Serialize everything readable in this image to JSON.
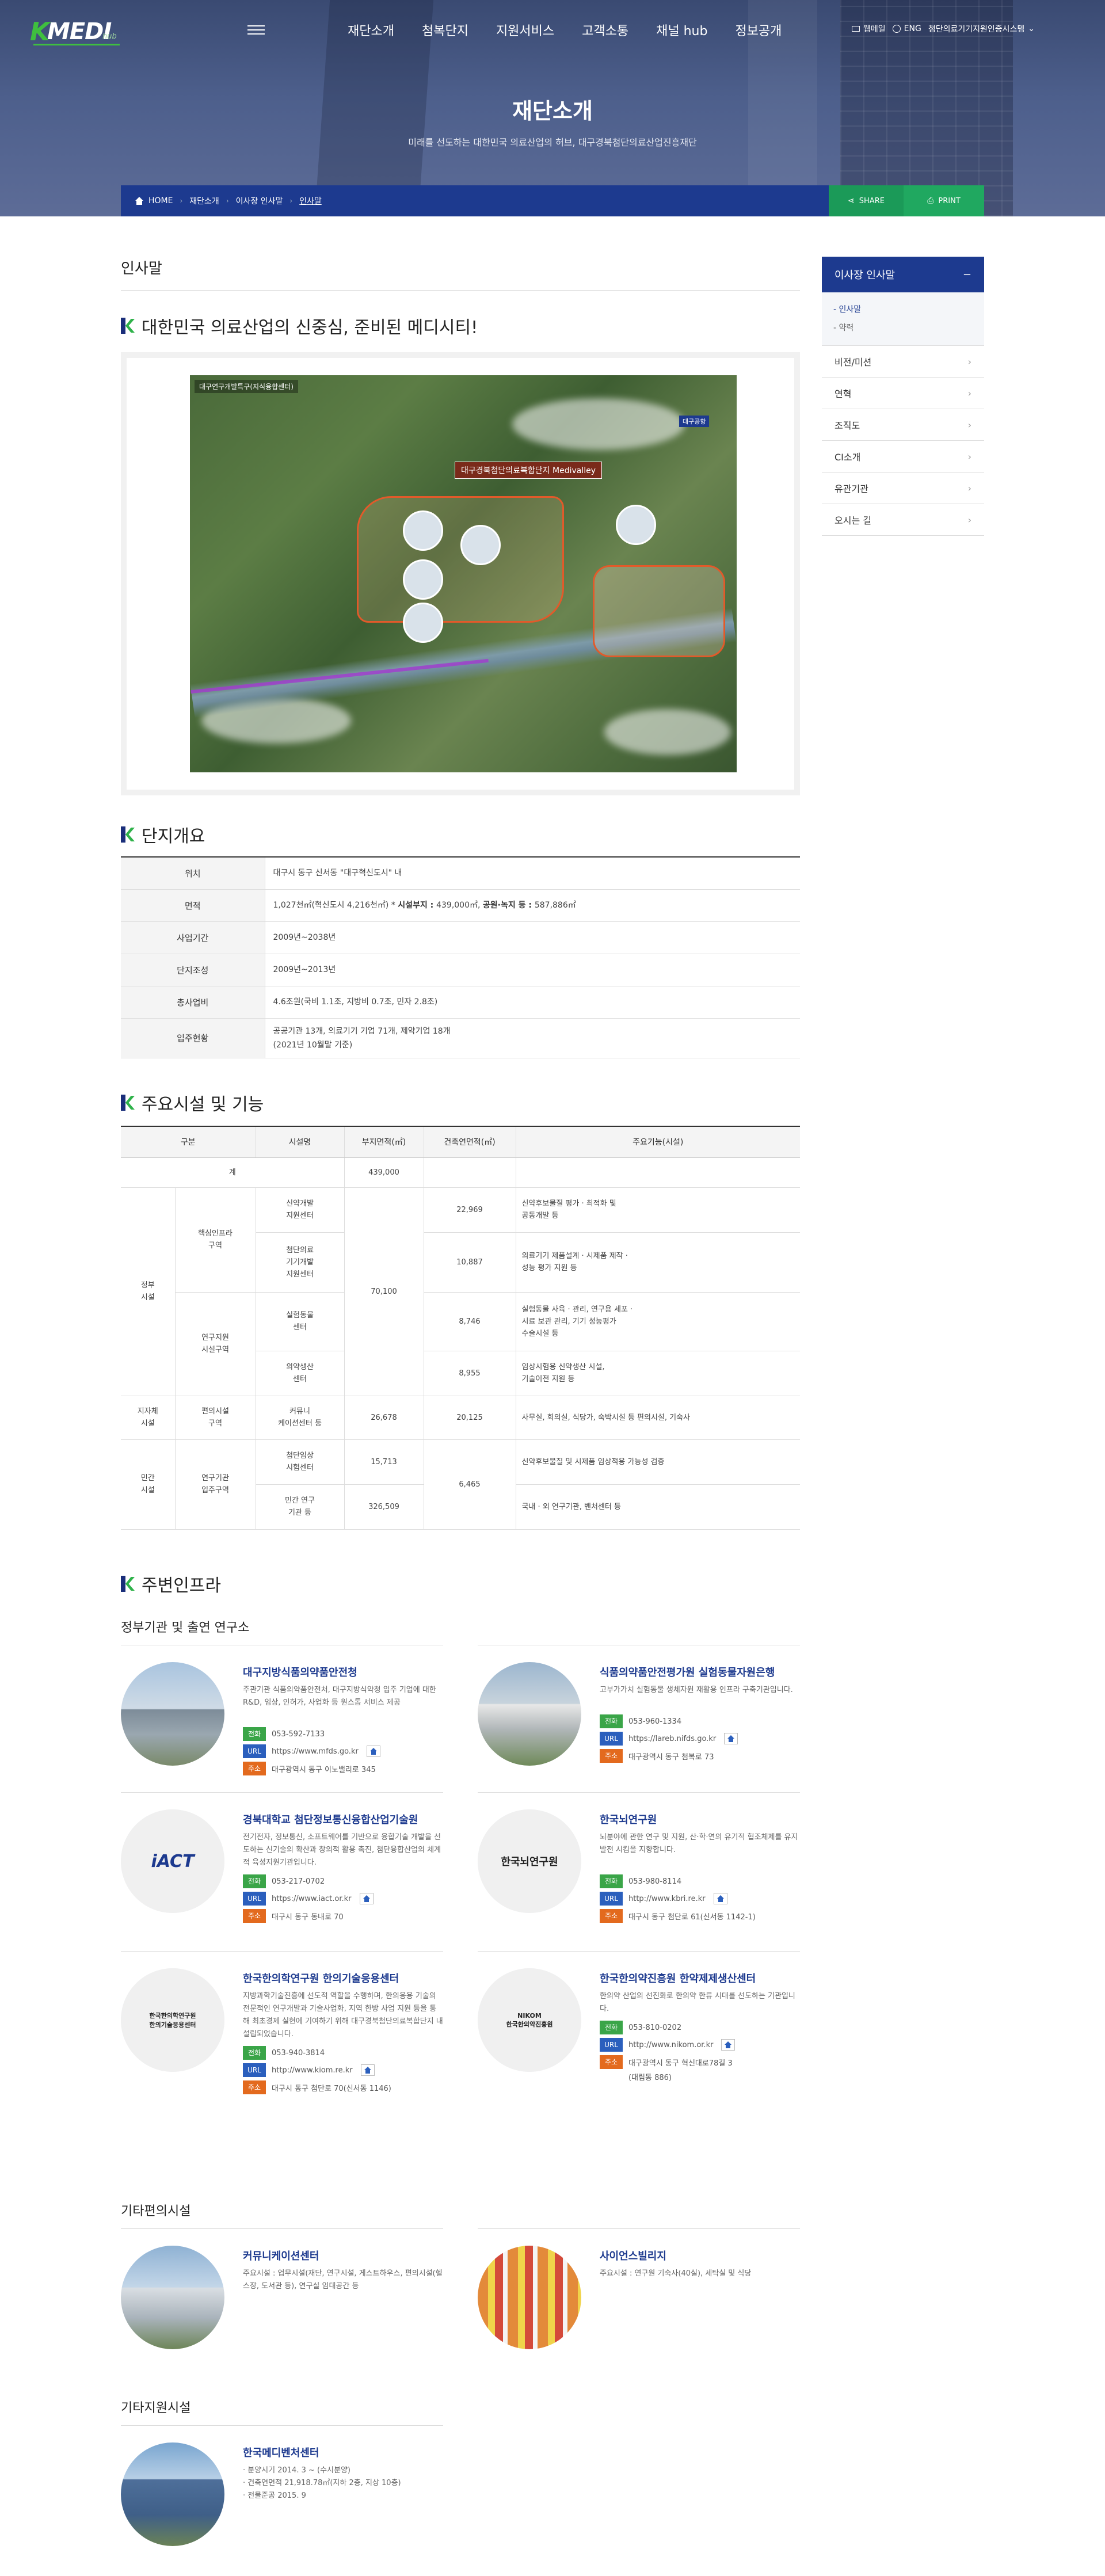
{
  "header": {
    "logo_text": "KMEDIhub",
    "nav": [
      "재단소개",
      "첨복단지",
      "지원서비스",
      "고객소통",
      "채널 hub",
      "정보공개"
    ],
    "util": {
      "sitemap": "웹메일",
      "english": "ENG",
      "family_site": "첨단의료기기지원인증시스템"
    }
  },
  "hero": {
    "title": "재단소개",
    "subtitle": "미래를 선도하는 대한민국 의료산업의 허브, 대구경북첨단의료산업진흥재단"
  },
  "breadcrumb": {
    "home": "HOME",
    "items": [
      "재단소개",
      "이사장 인사말",
      "인사말"
    ],
    "share": "SHARE",
    "print": "PRINT"
  },
  "page": {
    "title": "인사말",
    "section1_title": "대한민국 의료산업의 신중심, 준비된 메디시티!",
    "map": {
      "label_main": "대구경북첨단의료복합단지 Medivalley",
      "label_top": "대구연구개발특구(지식융합센터)",
      "label_right": "대구공항"
    },
    "section2_title": "단지개요",
    "overview": [
      {
        "label": "위치",
        "value": "대구시 동구 신서동 \"대구혁신도시\" 내"
      },
      {
        "label": "면적",
        "value_pre": "1,027천㎡(혁신도시 4,216천㎡)",
        "value_b1": "시설부지 : ",
        "value_b1v": "439,000㎡, ",
        "value_b2": "공원·녹지 등 : ",
        "value_b2v": "587,886㎡"
      },
      {
        "label": "사업기간",
        "value": "2009년~2038년"
      },
      {
        "label": "단지조성",
        "value": "2009년~2013년"
      },
      {
        "label": "총사업비",
        "value": "4.6조원(국비 1.1조, 지방비 0.7조, 민자 2.8조)"
      },
      {
        "label": "입주현황",
        "value": "공공기관 13개, 의료기기 기업 71개, 제약기업 18개",
        "value2": "(2021년 10월말 기준)"
      }
    ],
    "section3_title": "주요시설 및 기능",
    "facilities": {
      "headers": [
        "구분",
        "시설명",
        "부지면적(㎡)",
        "건축연면적(㎡)",
        "주요기능(시설)"
      ],
      "total_label": "계",
      "total_area": "439,000",
      "g1": "정부\n시설",
      "g1a": "핵심인프라\n구역",
      "g1b": "연구지원\n시설구역",
      "f1": "신약개발\n지원센터",
      "f1b": "22,969",
      "f1c": "신약후보물질 평가 · 최적화 및\n공동개발 등",
      "f2": "첨단의료\n기기개발\n지원센터",
      "f2b": "10,887",
      "f2c": "의료기기 제품설계 · 시제품 제작 ·\n성능 평가 지원 등",
      "f3": "실험동물\n센터",
      "f3b": "8,746",
      "f3c": "실험동물 사육 · 관리, 연구용 세포 ·\n시료 보관 관리, 기기 성능평가\n수술시설 등",
      "f4": "의약생산\n센터",
      "f4b": "8,955",
      "f4c": "임상시험용 신약생산 시설,\n기술이전 지원 등",
      "gov_area": "70,100",
      "g2": "지자체\n시설",
      "g2a": "편의시설\n구역",
      "f5": "커뮤니\n케이션센터 등",
      "f5a": "26,678",
      "f5b": "20,125",
      "f5c": "사무실, 회의실, 식당가, 숙박시설 등 편의시설, 기숙사",
      "g3": "민간\n시설",
      "g3a": "연구기관\n입주구역",
      "f6": "첨단임상\n시험센터",
      "f6a": "15,713",
      "f6c": "신약후보물질 및 시제품 임상적용 가능성 검증",
      "f7": "민간 연구\n기관 등",
      "f7a": "326,509",
      "f7c": "국내 · 외 연구기관, 벤처센터 등",
      "private_build": "6,465"
    },
    "section4_title": "주변인프라",
    "gov_sub": "정부기관 및 출연 연구소",
    "infra": [
      {
        "title": "대구지방식품의약품안전청",
        "desc": "주관기관 식품의약품안전처, 대구지방식약청 입주 기업에 대한 R&D, 임상, 인허가, 사업화 등 원스톱 서비스 제공",
        "tel": "053-592-7133",
        "url": "https://www.mfds.go.kr",
        "addr": "대구광역시 동구 이노밸리로 345"
      },
      {
        "title": "식품의약품안전평가원 실험동물자원은행",
        "desc": "고부가가치 실험동물 생체자원 재활용 인프라 구축기관입니다.",
        "tel": "053-960-1334",
        "url": "https://lareb.nifds.go.kr",
        "addr": "대구광역시 동구 첨복로 73"
      },
      {
        "title": "경북대학교 첨단정보통신융합산업기술원",
        "desc": "전기전자, 정보통신, 소프트웨어를 기반으로 융합기술 개발을 선도하는 신기술의 확산과 창의적 활용 촉진, 첨단융합산업의 체계적 육성지원기관입니다.",
        "tel": "053-217-0702",
        "url": "https://www.iact.or.kr",
        "addr": "대구시 동구 동내로 70",
        "logo": "iACT"
      },
      {
        "title": "한국뇌연구원",
        "desc": "뇌분야에 관한 연구 및 지원, 산·학·연의 유기적 협조체제를 유지 발전 시킴을 지향합니다.",
        "tel": "053-980-8114",
        "url": "http://www.kbri.re.kr",
        "addr": "대구시 동구 첨단로 61(신서동 1142-1)",
        "logo": "한국뇌연구원"
      },
      {
        "title": "한국한의학연구원 한의기술응용센터",
        "desc": "지방과학기술진흥에 선도적 역할을 수행하며, 한의응용 기술의 전문적인 연구개발과 기술사업화, 지역 한방 사업 지원 등을 통해 최초경제 실현에 기여하기 위해 대구경북첨단의료복합단지 내 설립되었습니다.",
        "tel": "053-940-3814",
        "url": "http://www.kiom.re.kr",
        "addr": "대구시 동구 첨단로 70(신서동 1146)",
        "logo": "한국한의학연구원\n한의기술응용센터"
      },
      {
        "title": "한국한의약진흥원 한약제제생산센터",
        "desc": "한의약 산업의 선진화로 한의약 한류 시대를 선도하는 기관입니다.",
        "tel": "053-810-0202",
        "url": "http://www.nikom.or.kr",
        "addr": "대구광역시 동구 혁신대로78길 3",
        "addr2": "(대림동 886)",
        "logo": "NIKOM\n한국한의약진흥원"
      }
    ],
    "etc_sub": "기타편의시설",
    "etc": [
      {
        "title": "커뮤니케이션센터",
        "desc": "주요시설 : 업무시설(재단, 연구시설, 게스트하우스, 편의시설(헬스장, 도서관 등), 연구실 임대공간 등"
      },
      {
        "title": "사이언스빌리지",
        "desc": "주요시설 : 연구원 기숙사(40실), 세탁실 및 식당"
      }
    ],
    "support_sub": "기타지원시설",
    "support": {
      "title": "한국메디벤처센터",
      "lines": [
        "· 분양시기 2014. 3 ~ (수시분양)",
        "· 건축연면적 21,918.78㎡(지하 2층, 지상 10층)",
        "· 전물준공 2015. 9"
      ]
    }
  },
  "sidebar": {
    "head": "이사장 인사말",
    "subs": [
      "- 인사말",
      "- 약력"
    ],
    "items": [
      "비전/미션",
      "연혁",
      "조직도",
      "CI소개",
      "유관기관",
      "오시는 길"
    ]
  }
}
